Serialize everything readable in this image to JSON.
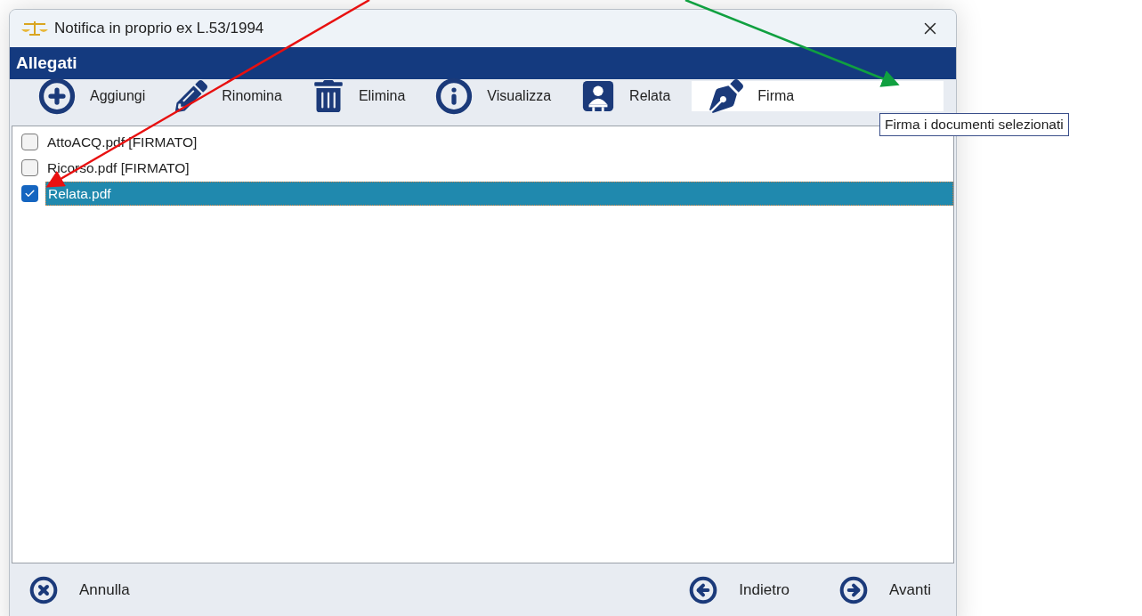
{
  "window": {
    "title": "Notifica in proprio ex L.53/1994"
  },
  "section": {
    "title": "Allegati"
  },
  "toolbar": [
    {
      "label": "Aggiungi",
      "selected": false
    },
    {
      "label": "Rinomina",
      "selected": false
    },
    {
      "label": "Elimina",
      "selected": false
    },
    {
      "label": "Visualizza",
      "selected": false
    },
    {
      "label": "Relata",
      "selected": false
    },
    {
      "label": "Firma",
      "selected": true
    }
  ],
  "tooltip": "Firma i documenti selezionati",
  "files": [
    {
      "name": "AttoACQ.pdf [FIRMATO]",
      "checked": false,
      "selected": false
    },
    {
      "name": "Ricorso.pdf [FIRMATO]",
      "checked": false,
      "selected": false
    },
    {
      "name": "Relata.pdf",
      "checked": true,
      "selected": true
    }
  ],
  "footer": {
    "left": [
      {
        "label": "Annulla"
      }
    ],
    "right": [
      {
        "label": "Indietro"
      },
      {
        "label": "Avanti"
      }
    ]
  }
}
